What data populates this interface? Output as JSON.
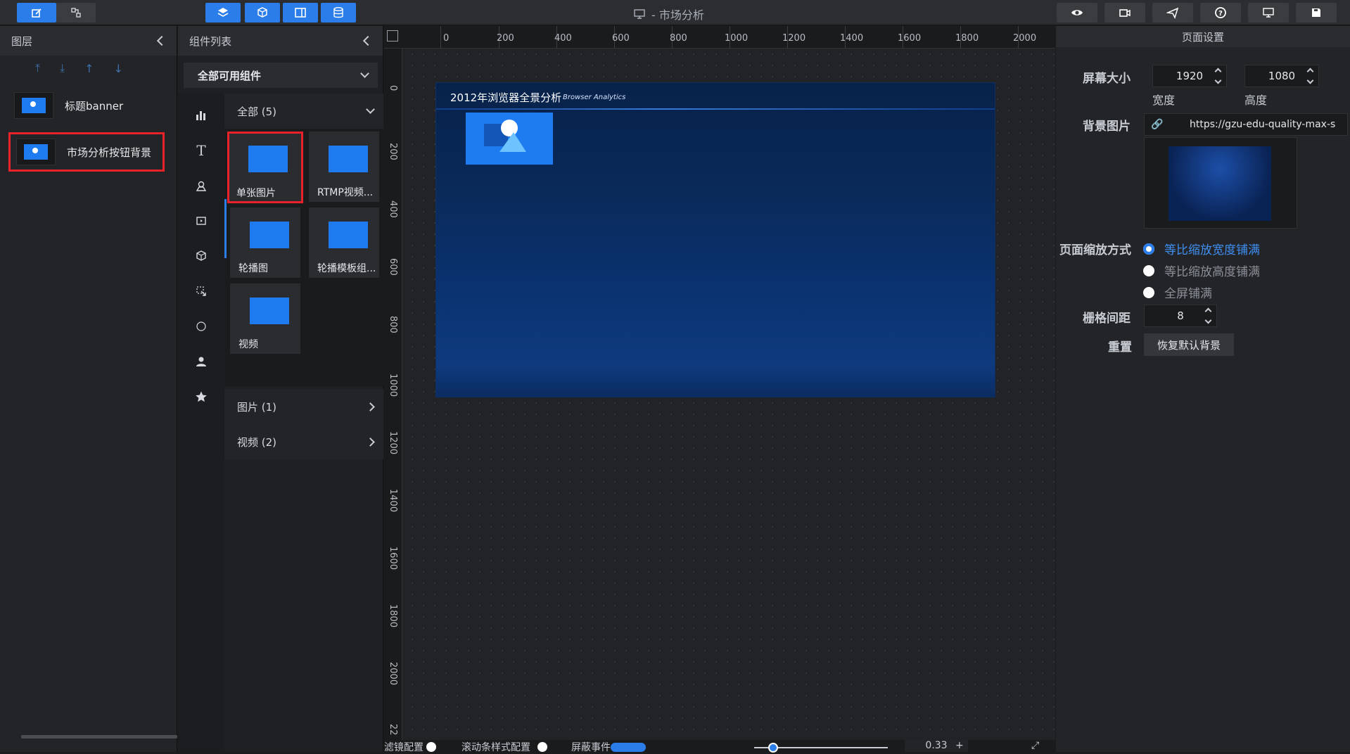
{
  "app": {
    "title": "- 市场分析"
  },
  "toolbar": {
    "left": [
      {
        "name": "edit",
        "icon": "edit-icon",
        "active": true
      },
      {
        "name": "flow",
        "icon": "flow-icon",
        "active": false
      }
    ],
    "center": [
      {
        "name": "layers",
        "icon": "layers-icon",
        "active": true
      },
      {
        "name": "components",
        "icon": "cube-icon",
        "active": true
      },
      {
        "name": "panel",
        "icon": "panel-icon",
        "active": true
      },
      {
        "name": "data",
        "icon": "database-icon",
        "active": true
      }
    ],
    "right": [
      "eye-icon",
      "camera-icon",
      "send-icon",
      "help-icon",
      "monitor-icon",
      "save-icon"
    ]
  },
  "layers_panel": {
    "title": "图层",
    "items": [
      {
        "label": "标题banner",
        "selected": false
      },
      {
        "label": "市场分析按钮背景",
        "selected": true
      }
    ]
  },
  "components_panel": {
    "title": "组件列表",
    "filter": "全部可用组件",
    "groups": [
      {
        "label": "全部 (5)",
        "expanded": true
      },
      {
        "label": "图片 (1)",
        "expanded": false
      },
      {
        "label": "视频 (2)",
        "expanded": false
      }
    ],
    "cards": [
      {
        "label": "单张图片",
        "selected": true
      },
      {
        "label": "RTMP视频...",
        "selected": false
      },
      {
        "label": "轮播图",
        "selected": false
      },
      {
        "label": "轮播模板组...",
        "selected": false
      },
      {
        "label": "视频",
        "selected": false
      }
    ]
  },
  "canvas": {
    "ruler_h": [
      "0",
      "200",
      "400",
      "600",
      "800",
      "1000",
      "1200",
      "1400",
      "1600",
      "1800",
      "2000"
    ],
    "ruler_v": [
      "0",
      "200",
      "400",
      "600",
      "800",
      "1000",
      "1200",
      "1400",
      "1600",
      "1800",
      "2000",
      "22"
    ],
    "screen_title": "2012年浏览器全景分析",
    "screen_subtitle": "Browser Analytics"
  },
  "settings": {
    "title": "页面设置",
    "screen_size_label": "屏幕大小",
    "width": "1920",
    "height": "1080",
    "width_label": "宽度",
    "height_label": "高度",
    "bg_image_label": "背景图片",
    "bg_image_url": "https://gzu-edu-quality-max-s",
    "scale_label": "页面缩放方式",
    "scale_options": [
      {
        "label": "等比缩放宽度铺满",
        "selected": true
      },
      {
        "label": "等比缩放高度铺满",
        "selected": false
      },
      {
        "label": "全屏铺满",
        "selected": false
      }
    ],
    "grid_label": "栅格间距",
    "grid_value": "8",
    "reset_label": "重置",
    "reset_button": "恢复默认背景"
  },
  "bottom_bar": {
    "items": [
      "滤镜配置",
      "滚动条样式配置",
      "屏蔽事件"
    ],
    "zoom": "0.33"
  },
  "colors": {
    "accent": "#2b7de9",
    "highlight": "#e8212b"
  }
}
